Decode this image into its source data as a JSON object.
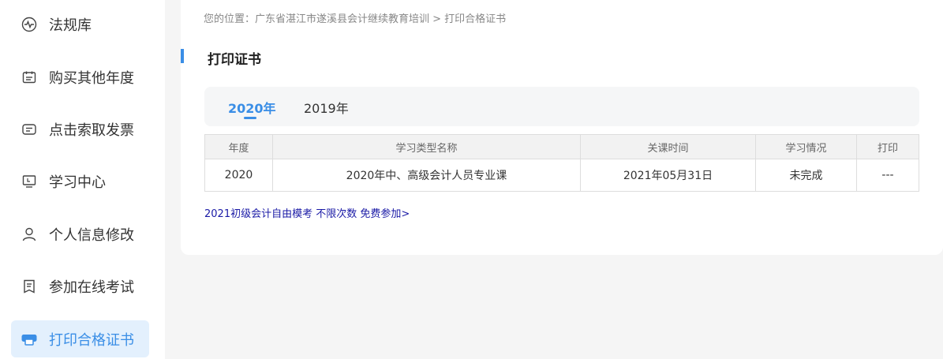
{
  "sidebar": {
    "items": [
      {
        "label": "法规库",
        "icon": "pulse-icon"
      },
      {
        "label": "购买其他年度",
        "icon": "calendar-icon"
      },
      {
        "label": "点击索取发票",
        "icon": "invoice-icon"
      },
      {
        "label": "学习中心",
        "icon": "monitor-icon"
      },
      {
        "label": "个人信息修改",
        "icon": "user-icon"
      },
      {
        "label": "参加在线考试",
        "icon": "exam-icon"
      },
      {
        "label": "打印合格证书",
        "icon": "printer-icon",
        "active": true
      }
    ]
  },
  "breadcrumb": "您的位置：广东省湛江市遂溪县会计继续教育培训 > 打印合格证书",
  "page_title": "打印证书",
  "tabs": [
    {
      "label": "2020年",
      "active": true
    },
    {
      "label": "2019年",
      "active": false
    }
  ],
  "table": {
    "headers": [
      "年度",
      "学习类型名称",
      "关课时间",
      "学习情况",
      "打印"
    ],
    "rows": [
      [
        "2020",
        "2020年中、高级会计人员专业课",
        "2021年05月31日",
        "未完成",
        "---"
      ]
    ]
  },
  "promo_link": "2021初级会计自由模考 不限次数 免费参加>",
  "colors": {
    "accent": "#3a8ee6",
    "active_bg": "#e3f0fd",
    "incomplete": "#d40000",
    "link": "#1a1aa6"
  }
}
